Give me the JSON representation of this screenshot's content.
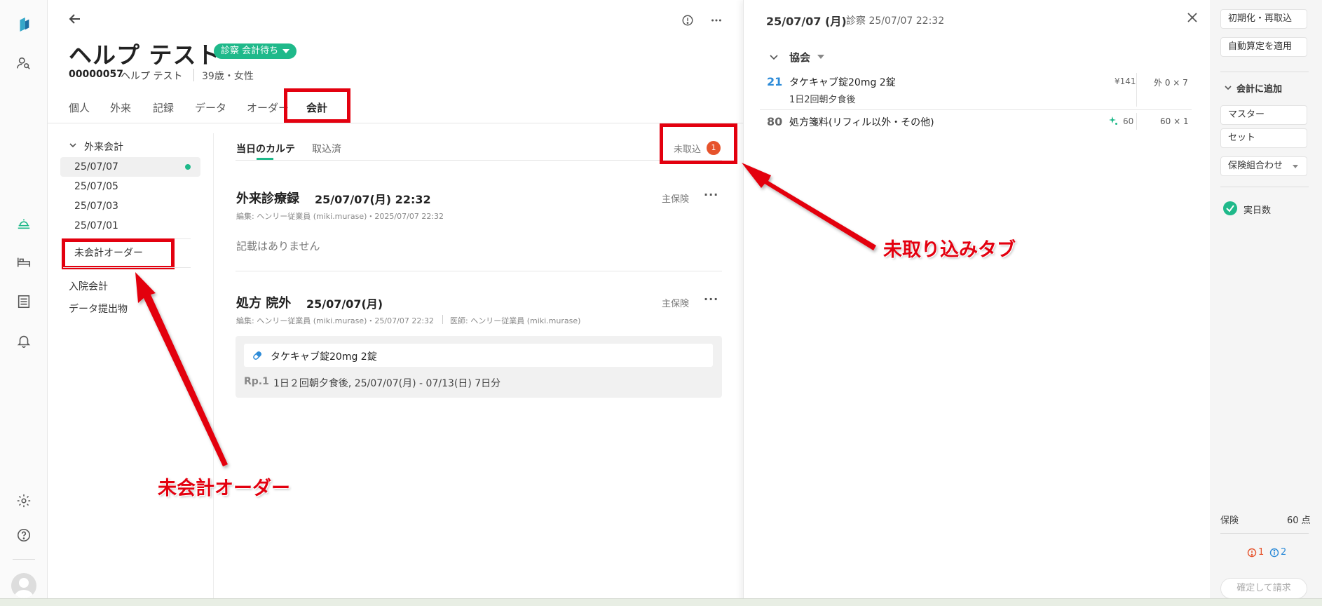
{
  "colors": {
    "accent": "#1fb98a",
    "annotation_red": "#e3000f",
    "badge": "#e6532c",
    "blue_code": "#2d8bd8"
  },
  "rail": {
    "icons": [
      "logo-icon",
      "patient-search-icon",
      "reception-bell-icon",
      "bed-icon",
      "list-icon",
      "notification-bell-icon",
      "gear-icon",
      "help-icon",
      "avatar"
    ]
  },
  "patient": {
    "name": "ヘルプ テスト",
    "status": "診察 会計待ち",
    "id": "00000057",
    "kana": "ヘルプ テスト",
    "age_sex": "39歳・女性"
  },
  "tabs": [
    {
      "label": "個人"
    },
    {
      "label": "外来"
    },
    {
      "label": "記録"
    },
    {
      "label": "データ"
    },
    {
      "label": "オーダー"
    },
    {
      "label": "会計"
    }
  ],
  "left_nav": {
    "section": "外来会計",
    "dates": [
      "25/07/07",
      "25/07/05",
      "25/07/03",
      "25/07/01"
    ],
    "unpaid_order": "未会計オーダー",
    "inpatient": "入院会計",
    "data_submission": "データ提出物"
  },
  "karte_tabs": {
    "today": "当日のカルテ",
    "imported": "取込済",
    "unimported": "未取込",
    "unimported_count": "1"
  },
  "records": [
    {
      "title": "外来診療録",
      "date": "25/07/07(月) 22:32",
      "meta": "編集: ヘンリー従業員 (miki.murase)・2025/07/07 22:32",
      "insurance": "主保険",
      "more": "···",
      "empty_text": "記載はありません"
    },
    {
      "title": "処方 院外",
      "date": "25/07/07(月)",
      "meta": "編集: ヘンリー従業員 (miki.murase)・25/07/07 22:32",
      "doctor": "医師: ヘンリー従業員 (miki.murase)",
      "insurance": "主保険",
      "more": "···",
      "drug": "タケキャブ錠20mg 2錠",
      "rp": "Rp.1",
      "detail": "1日２回朝夕食後, 25/07/07(月) - 07/13(日) 7日分"
    }
  ],
  "annotations": {
    "unimported_tab": "未取り込みタブ",
    "unpaid_order": "未会計オーダー"
  },
  "right_panel": {
    "date": "25/07/07 (月)",
    "exam": "診察 25/07/07 22:32",
    "group": "協会",
    "rows": [
      {
        "code": "21",
        "name": "タケキャブ錠20mg 2錠",
        "sub": "1日2回朝夕食後",
        "price": "¥141",
        "qty": "外 0 × 7"
      },
      {
        "code": "80",
        "name": "処方箋料(リフィル以外・その他)",
        "points": "60",
        "qty": "60 × 1"
      }
    ]
  },
  "side": {
    "reset": "初期化・再取込",
    "auto_calc": "自動算定を適用",
    "add_section": "会計に追加",
    "master": "マスター",
    "set": "セット",
    "insurance_combo": "保険組合わせ",
    "actual_days": "実日数",
    "insurance_label": "保険",
    "insurance_points": "60 点",
    "errors": "1",
    "infos": "2",
    "confirm": "確定して請求"
  }
}
